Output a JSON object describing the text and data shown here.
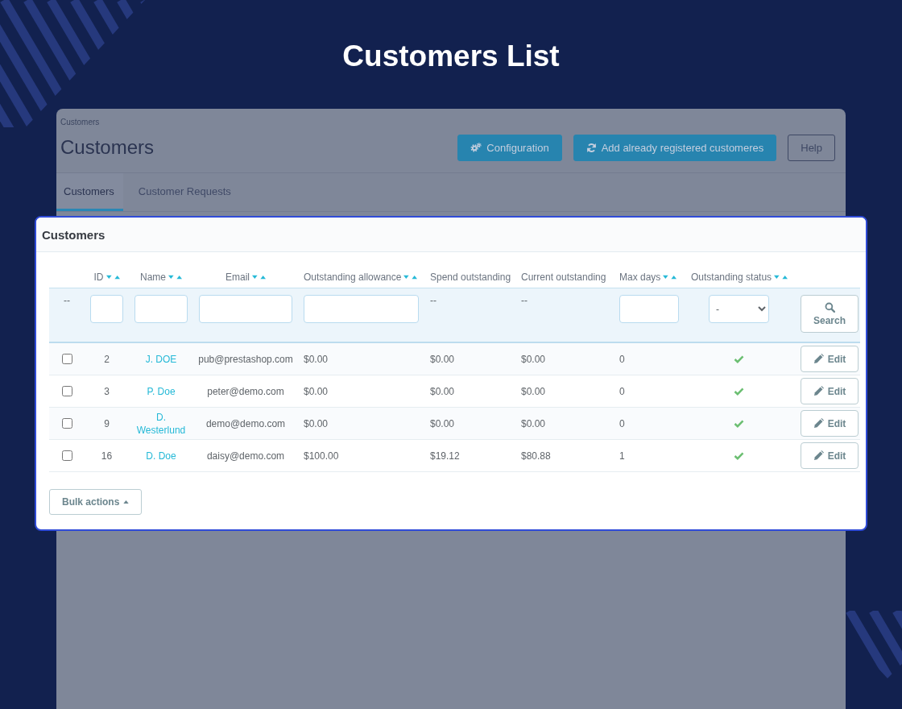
{
  "hero": {
    "title": "Customers List"
  },
  "background_panel": {
    "breadcrumb": "Customers",
    "heading": "Customers",
    "buttons": [
      {
        "label": "Configuration",
        "kind": "primary"
      },
      {
        "label": "Add already registered customeres",
        "kind": "primary"
      },
      {
        "label": "Help",
        "kind": "outline"
      }
    ],
    "tabs": [
      {
        "label": "Customers",
        "selected": true
      },
      {
        "label": "Customer Requests",
        "selected": false
      }
    ]
  },
  "card": {
    "title": "Customers",
    "columns": [
      {
        "label": "ID",
        "sortable": true
      },
      {
        "label": "Name",
        "sortable": true
      },
      {
        "label": "Email",
        "sortable": true
      },
      {
        "label": "Outstanding allowance",
        "sortable": true
      },
      {
        "label": "Spend outstanding",
        "sortable": false
      },
      {
        "label": "Current outstanding",
        "sortable": false
      },
      {
        "label": "Max days",
        "sortable": true
      },
      {
        "label": "Outstanding status",
        "sortable": true
      }
    ],
    "filters": [
      {
        "kind": "text",
        "text": "--"
      },
      {
        "kind": "input"
      },
      {
        "kind": "input"
      },
      {
        "kind": "input"
      },
      {
        "kind": "input"
      },
      {
        "kind": "text",
        "text": "--"
      },
      {
        "kind": "text",
        "text": "--"
      },
      {
        "kind": "input"
      },
      {
        "kind": "select",
        "value": "-"
      },
      {
        "kind": "button",
        "label": "Search"
      }
    ],
    "rows": [
      {
        "checked": false,
        "id": "2",
        "name": "J. DOE",
        "email": "pub@prestashop.com",
        "outstanding_allowance": "$0.00",
        "spend_outstanding": "$0.00",
        "current_outstanding": "$0.00",
        "max_days": "0",
        "status_ok": true,
        "action": "Edit"
      },
      {
        "checked": false,
        "id": "3",
        "name": "P. Doe",
        "email": "peter@demo.com",
        "outstanding_allowance": "$0.00",
        "spend_outstanding": "$0.00",
        "current_outstanding": "$0.00",
        "max_days": "0",
        "status_ok": true,
        "action": "Edit"
      },
      {
        "checked": false,
        "id": "9",
        "name": "D. Westerlund",
        "email": "demo@demo.com",
        "outstanding_allowance": "$0.00",
        "spend_outstanding": "$0.00",
        "current_outstanding": "$0.00",
        "max_days": "0",
        "status_ok": true,
        "action": "Edit"
      },
      {
        "checked": false,
        "id": "16",
        "name": "D. Doe",
        "email": "daisy@demo.com",
        "outstanding_allowance": "$100.00",
        "spend_outstanding": "$19.12",
        "current_outstanding": "$80.88",
        "max_days": "1",
        "status_ok": true,
        "action": "Edit"
      }
    ],
    "bulk_actions": {
      "label": "Bulk actions"
    }
  }
}
